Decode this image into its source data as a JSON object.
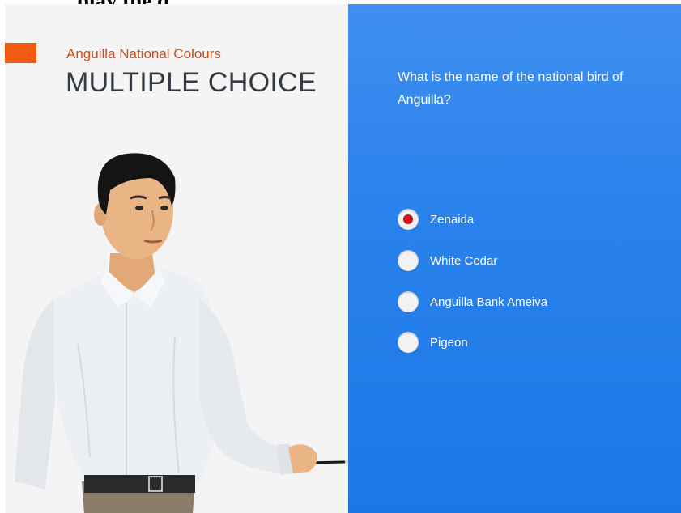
{
  "header": {
    "partial_text": "play the q"
  },
  "slide": {
    "subtitle": "Anguilla National Colours",
    "title": "MULTIPLE CHOICE",
    "question": "What is the name of the  national bird of Anguilla?",
    "options": [
      {
        "label": "Zenaida",
        "selected": true
      },
      {
        "label": "White Cedar",
        "selected": false
      },
      {
        "label": "Anguilla Bank Ameiva",
        "selected": false
      },
      {
        "label": "Pigeon",
        "selected": false
      }
    ]
  },
  "colors": {
    "accent_orange": "#f05a12",
    "subtitle_text": "#c8501c",
    "title_text": "#333a42",
    "panel_blue": "#2a82ec",
    "radio_selected": "#c8141e"
  },
  "icons": {
    "illustration": "presenter-with-pointer-illustration"
  }
}
